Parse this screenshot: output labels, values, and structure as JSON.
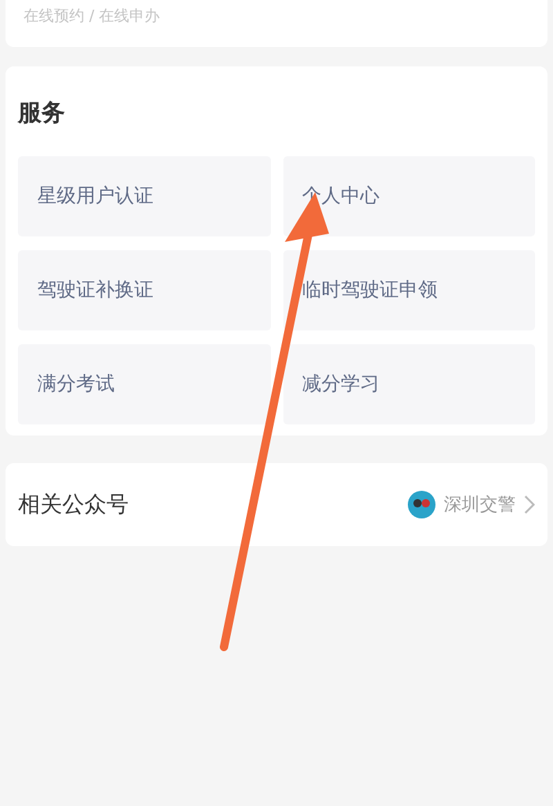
{
  "top_card": {
    "subtitle": "在线预约 / 在线申办"
  },
  "services": {
    "title": "服务",
    "items": [
      {
        "label": "星级用户认证"
      },
      {
        "label": "个人中心"
      },
      {
        "label": "驾驶证补换证"
      },
      {
        "label": "临时驾驶证申领"
      },
      {
        "label": "满分考试"
      },
      {
        "label": "减分学习"
      }
    ]
  },
  "official_accounts": {
    "title": "相关公众号",
    "account": "深圳交警"
  }
}
